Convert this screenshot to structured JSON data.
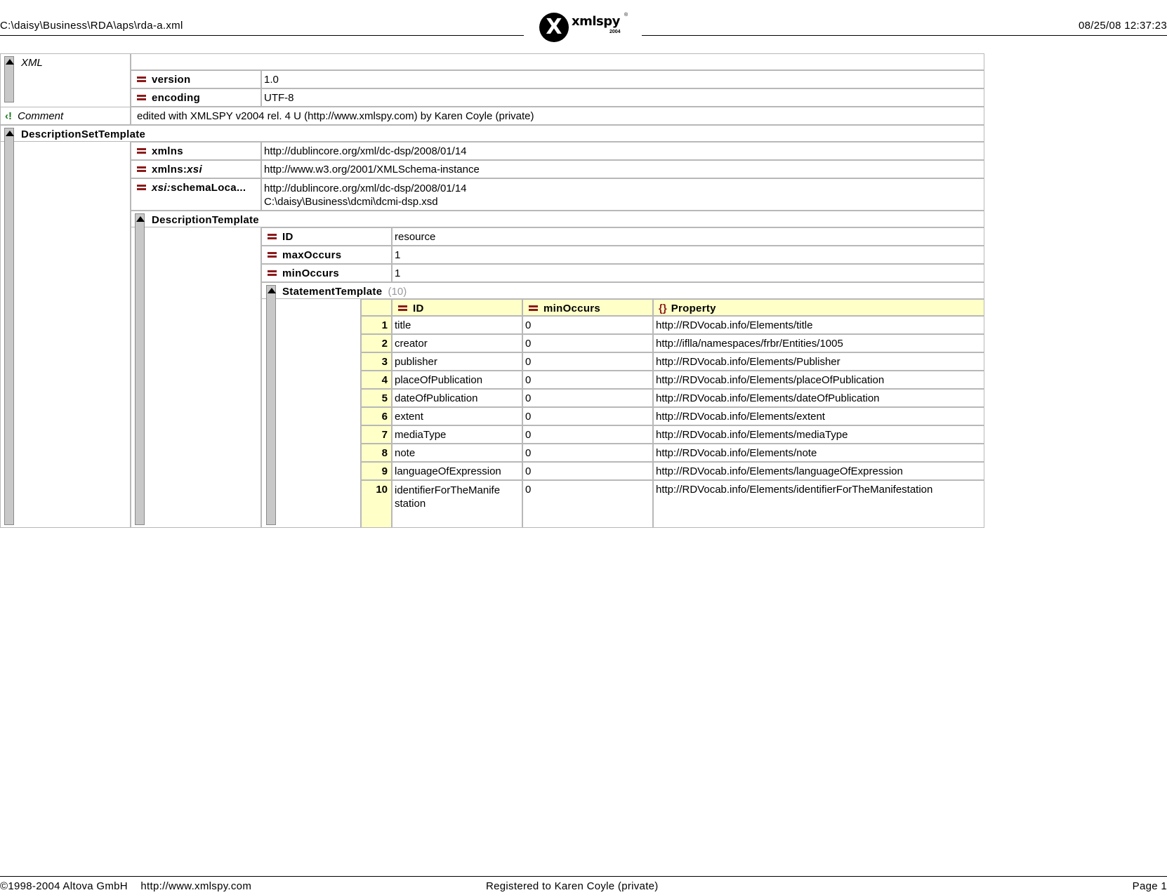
{
  "header": {
    "path": "C:\\daisy\\Business\\RDA\\aps\\rda-a.xml",
    "datetime": "08/25/08 12:37:23",
    "logo": {
      "mark": "X",
      "word": "xmlspy",
      "year": "2004",
      "reg": "®"
    }
  },
  "footer": {
    "copyright": "©1998-2004 Altova GmbH",
    "url": "http://www.xmlspy.com",
    "registered": "Registered to Karen Coyle (private)",
    "page": "Page 1"
  },
  "xml": {
    "label": "XML",
    "version_label": "version",
    "version_value": "1.0",
    "encoding_label": "encoding",
    "encoding_value": "UTF-8"
  },
  "comment": {
    "label": "Comment",
    "text": "edited with XMLSPY v2004 rel. 4 U (http://www.xmlspy.com) by Karen Coyle (private)"
  },
  "dst": {
    "label": "DescriptionSetTemplate",
    "xmlns_label": "xmlns",
    "xmlns_value": "http://dublincore.org/xml/dc-dsp/2008/01/14",
    "xmlnsxsi_prefix": "xmlns:",
    "xmlnsxsi_suffix": "xsi",
    "xmlnsxsi_value": "http://www.w3.org/2001/XMLSchema-instance",
    "schema_prefix": "xsi:",
    "schema_suffix": "schemaLoca...",
    "schema_value_1": "http://dublincore.org/xml/dc-dsp/2008/01/14",
    "schema_value_2": "C:\\daisy\\Business\\dcmi\\dcmi-dsp.xsd"
  },
  "dt": {
    "label": "DescriptionTemplate",
    "id_label": "ID",
    "id_value": "resource",
    "max_label": "maxOccurs",
    "max_value": "1",
    "min_label": "minOccurs",
    "min_value": "1"
  },
  "st": {
    "label": "StatementTemplate",
    "count": "(10)",
    "col_id": "ID",
    "col_min": "minOccurs",
    "col_prop": "Property",
    "prop_icon": "{}",
    "rows": [
      {
        "n": "1",
        "id": "title",
        "min": "0",
        "prop": "http://RDVocab.info/Elements/title"
      },
      {
        "n": "2",
        "id": "creator",
        "min": "0",
        "prop": "http://iflla/namespaces/frbr/Entities/1005"
      },
      {
        "n": "3",
        "id": "publisher",
        "min": "0",
        "prop": "http://RDVocab.info/Elements/Publisher"
      },
      {
        "n": "4",
        "id": "placeOfPublication",
        "min": "0",
        "prop": "http://RDVocab.info/Elements/placeOfPublication"
      },
      {
        "n": "5",
        "id": "dateOfPublication",
        "min": "0",
        "prop": "http://RDVocab.info/Elements/dateOfPublication"
      },
      {
        "n": "6",
        "id": "extent",
        "min": "0",
        "prop": "http://RDVocab.info/Elements/extent"
      },
      {
        "n": "7",
        "id": "mediaType",
        "min": "0",
        "prop": "http://RDVocab.info/Elements/mediaType"
      },
      {
        "n": "8",
        "id": "note",
        "min": "0",
        "prop": "http://RDVocab.info/Elements/note"
      },
      {
        "n": "9",
        "id": "languageOfExpression",
        "min": "0",
        "prop": "http://RDVocab.info/Elements/languageOfExpression"
      },
      {
        "n": "10",
        "id_1": "identifierForTheManife",
        "id_2": "station",
        "min": "0",
        "prop": "http://RDVocab.info/Elements/identifierForTheManifestation"
      }
    ]
  },
  "colors": {
    "attr_icon": "#8b1a1a",
    "header_fill": "#ffffc8",
    "grid_line": "#b8b8b8",
    "comment_icon": "#1a7a1a"
  }
}
